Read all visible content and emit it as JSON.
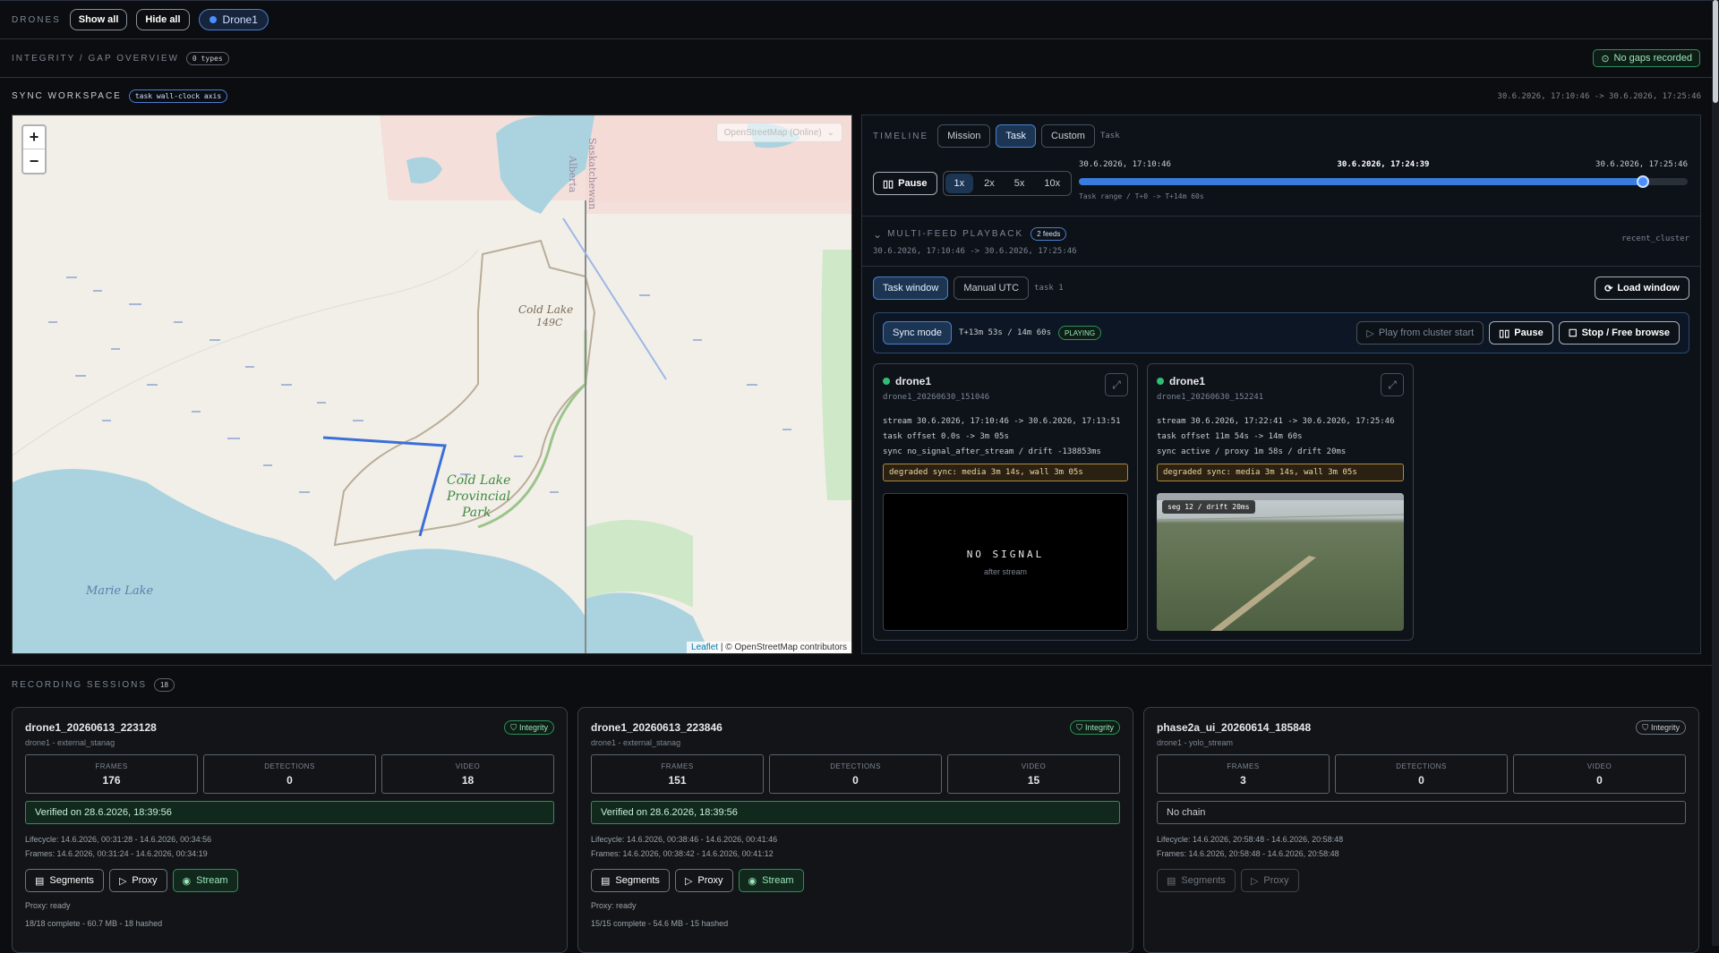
{
  "top": {
    "label": "DRONES",
    "show_all": "Show all",
    "hide_all": "Hide all",
    "drone": "Drone1"
  },
  "integrity": {
    "label": "INTEGRITY / GAP OVERVIEW",
    "types": "0 types",
    "status": "No gaps recorded"
  },
  "sync": {
    "label": "SYNC WORKSPACE",
    "axis": "task wall-clock axis",
    "range": "30.6.2026, 17:10:46 -> 30.6.2026, 17:25:46"
  },
  "map": {
    "layer": "OpenStreetMap (Online)",
    "attr_link": "Leaflet",
    "attr_text": "| © OpenStreetMap contributors",
    "labels": {
      "lake1": "Cold Lake",
      "lake1b": "149C",
      "park1": "Cold Lake",
      "park2": "Provincial",
      "park3": "Park",
      "marie": "Marie Lake",
      "alberta": "Alberta",
      "sask": "Saskatchewan"
    }
  },
  "timeline": {
    "label": "TIMELINE",
    "tabs": [
      "Mission",
      "Task",
      "Custom"
    ],
    "tab_note": "Task",
    "pause": "Pause",
    "speeds": [
      "1x",
      "2x",
      "5x",
      "10x"
    ],
    "start": "30.6.2026, 17:10:46",
    "current": "30.6.2026, 17:24:39",
    "end": "30.6.2026, 17:25:46",
    "progress": 0.927,
    "range_note": "Task range / T+0 -> T+14m 60s"
  },
  "multifeed": {
    "label": "MULTI-FEED PLAYBACK",
    "feeds": "2 feeds",
    "range": "30.6.2026, 17:10:46 -> 30.6.2026, 17:25:46",
    "cluster": "recent_cluster"
  },
  "window": {
    "task_window": "Task window",
    "manual_utc": "Manual UTC",
    "task_note": "task 1",
    "load": "Load window"
  },
  "syncbar": {
    "mode": "Sync mode",
    "time": "T+13m 53s / 14m 60s",
    "state": "PLAYING",
    "play_cluster": "Play from cluster start",
    "pause": "Pause",
    "stop": "Stop / Free browse"
  },
  "feeds": [
    {
      "name": "drone1",
      "id": "drone1_20260630_151046",
      "stream": "stream 30.6.2026, 17:10:46 -> 30.6.2026, 17:13:51",
      "offset": "task offset 0.0s -> 3m 05s",
      "sync": "sync no_signal_after_stream / drift -138853ms",
      "degraded": "degraded sync: media 3m 14s, wall 3m 05s",
      "nosignal": "NO SIGNAL",
      "after": "after stream"
    },
    {
      "name": "drone1",
      "id": "drone1_20260630_152241",
      "stream": "stream 30.6.2026, 17:22:41 -> 30.6.2026, 17:25:46",
      "offset": "task offset 11m 54s -> 14m 60s",
      "sync": "sync active / proxy 1m 58s / drift 20ms",
      "degraded": "degraded sync: media 3m 14s, wall 3m 05s",
      "seg": "seg 12 / drift 20ms"
    }
  ],
  "sessions": {
    "label": "RECORDING SESSIONS",
    "count": "18",
    "cards": [
      {
        "title": "drone1_20260613_223128",
        "sub": "drone1 - external_stanag",
        "badge": "Integrity",
        "frames": "176",
        "detections": "0",
        "video": "18",
        "verify": "Verified on 28.6.2026, 18:39:56",
        "lifecycle": "Lifecycle: 14.6.2026, 00:31:28 - 14.6.2026, 00:34:56",
        "framesr": "Frames: 14.6.2026, 00:31:24 - 14.6.2026, 00:34:19",
        "proxy": "Proxy: ready",
        "complete": "18/18 complete - 60.7 MB - 18 hashed"
      },
      {
        "title": "drone1_20260613_223846",
        "sub": "drone1 - external_stanag",
        "badge": "Integrity",
        "frames": "151",
        "detections": "0",
        "video": "15",
        "verify": "Verified on 28.6.2026, 18:39:56",
        "lifecycle": "Lifecycle: 14.6.2026, 00:38:46 - 14.6.2026, 00:41:46",
        "framesr": "Frames: 14.6.2026, 00:38:42 - 14.6.2026, 00:41:12",
        "proxy": "Proxy: ready",
        "complete": "15/15 complete - 54.6 MB - 15 hashed"
      },
      {
        "title": "phase2a_ui_20260614_185848",
        "sub": "drone1 - yolo_stream",
        "badge": "Integrity",
        "frames": "3",
        "detections": "0",
        "video": "0",
        "verify": "No chain",
        "lifecycle": "Lifecycle: 14.6.2026, 20:58:48 - 14.6.2026, 20:58:48",
        "framesr": "Frames: 14.6.2026, 20:58:48 - 14.6.2026, 20:58:48"
      }
    ],
    "k_frames": "FRAMES",
    "k_det": "DETECTIONS",
    "k_video": "VIDEO",
    "segments": "Segments",
    "proxyb": "Proxy",
    "stream": "Stream"
  },
  "colors": {
    "accent": "#4a7fd0",
    "ok": "#2fbf73",
    "track": "#3a6fd8"
  }
}
